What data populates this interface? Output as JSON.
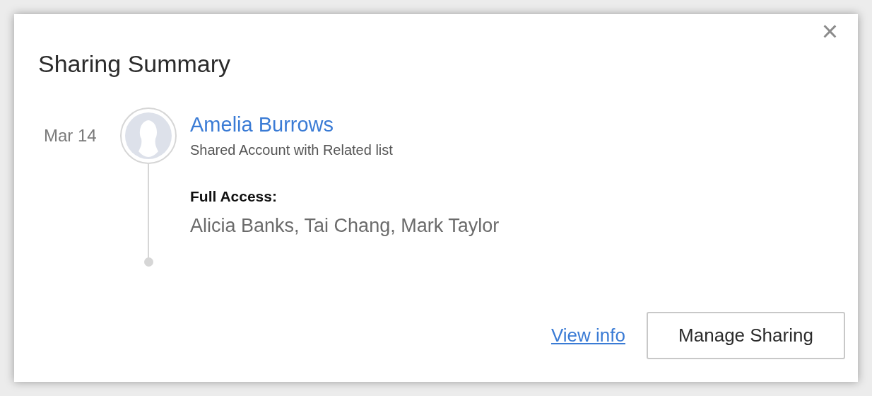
{
  "dialog": {
    "title": "Sharing Summary",
    "close": "×"
  },
  "entries": [
    {
      "date": "Mar 14",
      "name": "Amelia Burrows",
      "description": "Shared Account with Related list",
      "access_label": "Full Access:",
      "users": "Alicia Banks, Tai Chang, Mark Taylor"
    }
  ],
  "footer": {
    "link": "View info",
    "button": "Manage Sharing"
  }
}
